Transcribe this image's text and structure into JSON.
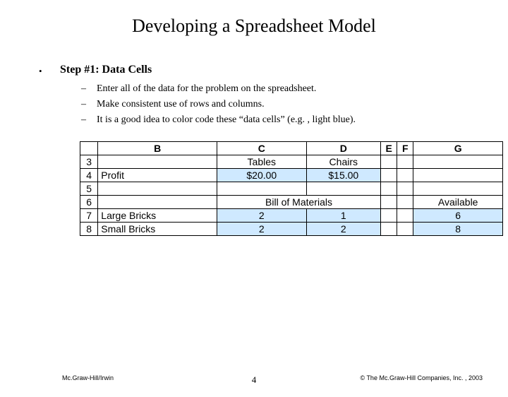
{
  "title": "Developing a Spreadsheet Model",
  "step": {
    "heading": "Step #1: Data Cells"
  },
  "sub": {
    "a": "Enter all of the data for the problem on the spreadsheet.",
    "b": "Make consistent use of rows and columns.",
    "c": "It is a good idea to color code these “data cells” (e.g. , light blue)."
  },
  "cols": {
    "B": "B",
    "C": "C",
    "D": "D",
    "E": "E",
    "F": "F",
    "G": "G"
  },
  "rows": {
    "r3": {
      "n": "3",
      "B": "",
      "C": "Tables",
      "D": "Chairs",
      "E": "",
      "F": "",
      "G": ""
    },
    "r4": {
      "n": "4",
      "B": "Profit",
      "C": "$20.00",
      "D": "$15.00",
      "E": "",
      "F": "",
      "G": ""
    },
    "r5": {
      "n": "5",
      "B": "",
      "C": "",
      "D": "",
      "E": "",
      "F": "",
      "G": ""
    },
    "r6": {
      "n": "6",
      "B": "",
      "C": "Bill of Materials",
      "E": "",
      "F": "",
      "G": "Available"
    },
    "r7": {
      "n": "7",
      "B": "Large Bricks",
      "C": "2",
      "D": "1",
      "E": "",
      "F": "",
      "G": "6"
    },
    "r8": {
      "n": "8",
      "B": "Small Bricks",
      "C": "2",
      "D": "2",
      "E": "",
      "F": "",
      "G": "8"
    }
  },
  "footer": {
    "left": "Mc.Graw-Hill/Irwin",
    "page": "4",
    "right": "© The Mc.Graw-Hill Companies, Inc. , 2003"
  },
  "chart_data": {
    "type": "table",
    "title": "Spreadsheet data cells",
    "columns": [
      "",
      "B",
      "C",
      "D",
      "E",
      "F",
      "G"
    ],
    "rows": [
      [
        "3",
        "",
        "Tables",
        "Chairs",
        "",
        "",
        ""
      ],
      [
        "4",
        "Profit",
        "$20.00",
        "$15.00",
        "",
        "",
        ""
      ],
      [
        "5",
        "",
        "",
        "",
        "",
        "",
        ""
      ],
      [
        "6",
        "",
        "Bill of Materials",
        "",
        "",
        "",
        "Available"
      ],
      [
        "7",
        "Large Bricks",
        2,
        1,
        "",
        "",
        6
      ],
      [
        "8",
        "Small Bricks",
        2,
        2,
        "",
        "",
        8
      ]
    ],
    "highlighted_data_cells": [
      "C4",
      "D4",
      "C7",
      "D7",
      "G7",
      "C8",
      "D8",
      "G8"
    ]
  }
}
